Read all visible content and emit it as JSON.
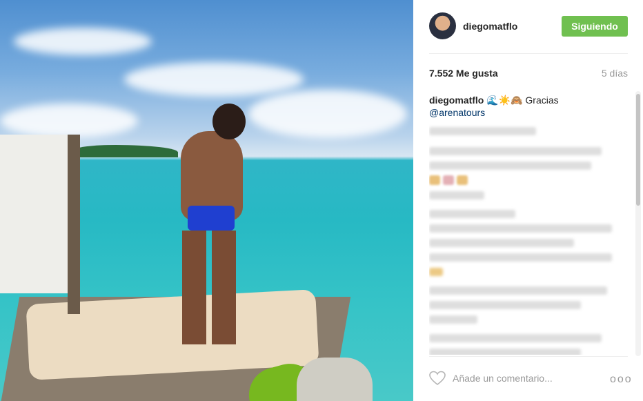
{
  "post": {
    "username": "diegomatflo",
    "follow_label": "Siguiendo",
    "likes": "7.552 Me gusta",
    "time": "5 días",
    "caption": {
      "username": "diegomatflo",
      "emojis": "🌊☀️🙈",
      "text": "Gracias",
      "mention": "@arenatours"
    },
    "comment_placeholder": "Añade un comentario...",
    "more_label": "ooo"
  },
  "colors": {
    "follow_green": "#70c050",
    "link_blue": "#003569",
    "muted_grey": "#999999"
  },
  "icons": [
    "heart-icon",
    "more-options-icon"
  ]
}
